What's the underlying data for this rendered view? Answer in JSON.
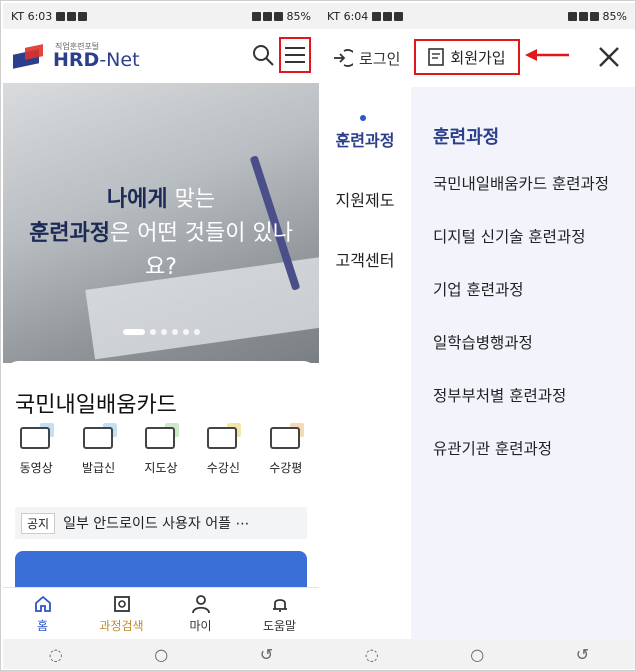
{
  "status_left": {
    "time": "KT 6:03",
    "battery": "85%"
  },
  "status_right": {
    "time": "KT 6:04",
    "battery": "85%"
  },
  "header": {
    "logo_sub": "직업훈련포털",
    "logo_main": "HRD",
    "logo_net": "-Net"
  },
  "hero": {
    "line1_bold": "나에게",
    "line1_rest": " 맞는",
    "line2_bold": "훈련과정",
    "line2_rest": "은 어떤 것들이 있나",
    "line3": "요?"
  },
  "card": {
    "title": "국민내일배움카드",
    "quick_links": [
      {
        "label": "동영상",
        "icon": "monitor-icon"
      },
      {
        "label": "발급신",
        "icon": "card-icon"
      },
      {
        "label": "지도상",
        "icon": "consult-icon"
      },
      {
        "label": "수강신",
        "icon": "check-icon"
      },
      {
        "label": "수강평",
        "icon": "review-icon"
      }
    ],
    "notice_tag": "공지",
    "notice_text": "일부 안드로이드 사용자 어플 ⋯"
  },
  "tabbar": {
    "items": [
      {
        "label": "홈",
        "icon": "home-icon"
      },
      {
        "label": "과정검색",
        "icon": "search-doc-icon"
      },
      {
        "label": "마이",
        "icon": "person-icon"
      },
      {
        "label": "도움말",
        "icon": "bell-icon"
      }
    ]
  },
  "drawer": {
    "login": "로그인",
    "join": "회원가입",
    "side_items": [
      "훈련과정",
      "지원제도",
      "고객센터"
    ],
    "panel_title": "훈련과정",
    "panel_items": [
      "국민내일배움카드 훈련과정",
      "디지털 신기술 훈련과정",
      "기업 훈련과정",
      "일학습병행과정",
      "정부부처별 훈련과정",
      "유관기관 훈련과정"
    ]
  },
  "colors": {
    "brand": "#2b3f8c",
    "accent_red": "#e0171b",
    "blue": "#2b55c8"
  }
}
